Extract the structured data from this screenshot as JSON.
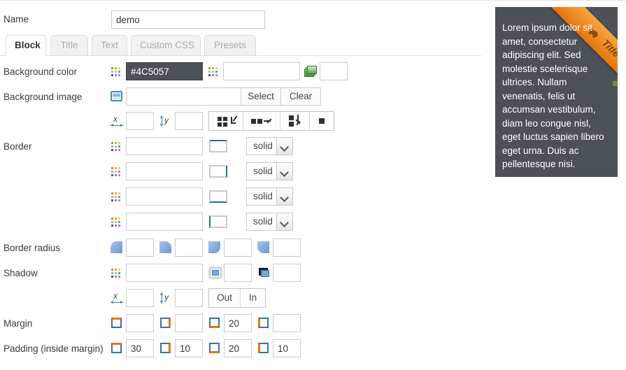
{
  "form": {
    "name": {
      "label": "Name",
      "value": "demo"
    },
    "tabs": [
      {
        "label": "Block",
        "active": true
      },
      {
        "label": "Title",
        "active": false
      },
      {
        "label": "Text",
        "active": false
      },
      {
        "label": "Custom CSS",
        "active": false
      },
      {
        "label": "Presets",
        "active": false
      }
    ],
    "background_color": {
      "label": "Background color",
      "value": "#4C5057",
      "second_value": "",
      "third_value": ""
    },
    "background_image": {
      "label": "Background image",
      "value": "",
      "select_label": "Select",
      "clear_label": "Clear",
      "offset_x_label": "x",
      "offset_x": "",
      "offset_y_label": "y",
      "offset_y": "",
      "repeat_options": [
        "repeat",
        "repeat-x",
        "repeat-y",
        "no-repeat"
      ]
    },
    "border": {
      "label": "Border",
      "rows": [
        {
          "side": "top",
          "width": "",
          "color": "",
          "style": "solid"
        },
        {
          "side": "right",
          "width": "",
          "color": "",
          "style": "solid"
        },
        {
          "side": "bottom",
          "width": "",
          "color": "",
          "style": "solid"
        },
        {
          "side": "left",
          "width": "",
          "color": "",
          "style": "solid"
        }
      ]
    },
    "border_radius": {
      "label": "Border radius",
      "corners": [
        {
          "corner": "top-left",
          "value": ""
        },
        {
          "corner": "top-right",
          "value": ""
        },
        {
          "corner": "bottom-right",
          "value": ""
        },
        {
          "corner": "bottom-left",
          "value": ""
        }
      ]
    },
    "shadow": {
      "label": "Shadow",
      "color": "",
      "blur": "",
      "spread": "",
      "offset_x_label": "x",
      "offset_x": "",
      "offset_y_label": "y",
      "offset_y": "",
      "out_label": "Out",
      "in_label": "In"
    },
    "margin": {
      "label": "Margin",
      "top": "",
      "right": "",
      "bottom": "20",
      "left": ""
    },
    "padding": {
      "label": "Padding (inside margin)",
      "top": "30",
      "right": "10",
      "bottom": "20",
      "left": "10"
    }
  },
  "preview": {
    "ribbon_title": "Title",
    "text": "Lorem ipsum dolor sit amet, consectetur adipiscing elit. Sed molestie scelerisque ultrices. Nullam venenatis, felis ut accumsan vestibulum, diam leo congue nisl, eget luctus sapien libero eget urna. Duis ac pellentesque nisi.",
    "background_color": "#4C5057",
    "ribbon_color": "#e8740c"
  }
}
